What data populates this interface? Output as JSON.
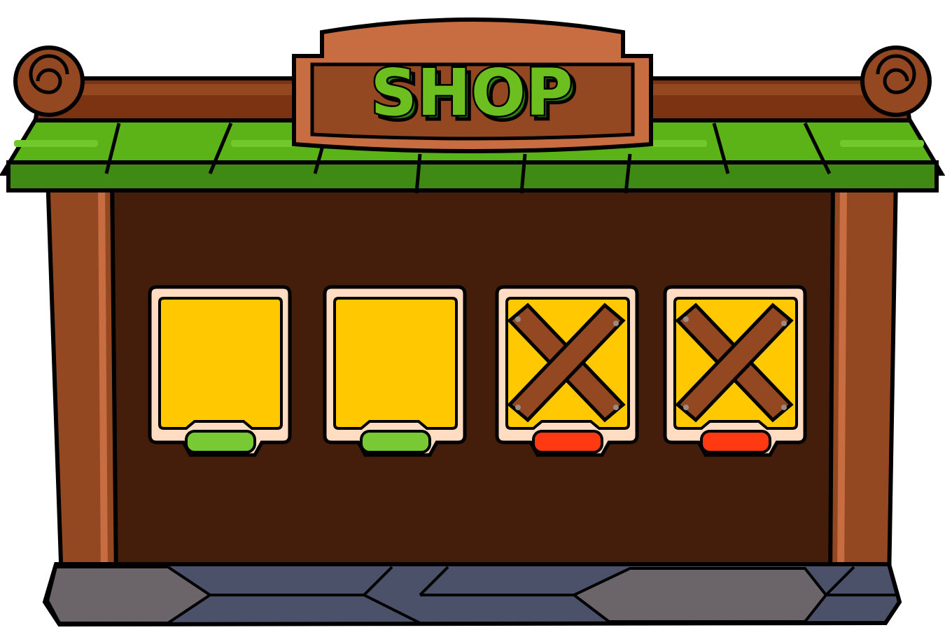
{
  "sign": {
    "title": "SHOP"
  },
  "slots": [
    {
      "state": "available",
      "button_color": "#79c934"
    },
    {
      "state": "available",
      "button_color": "#79c934"
    },
    {
      "state": "locked",
      "button_color": "#ff3a12"
    },
    {
      "state": "locked",
      "button_color": "#ff3a12"
    }
  ],
  "colors": {
    "roof_green": "#5cb318",
    "roof_green_dark": "#3f8a14",
    "wood": "#934821",
    "wood_light": "#c86c41",
    "back_panel": "#451d0b",
    "slot_fill": "#ffc800",
    "slot_frame": "#ffdcc2",
    "stone": "#4b5169",
    "stone_gray": "#6b6468",
    "title_green": "#6cbf1f"
  },
  "icons": {
    "locked_slot": "crossed-planks-icon",
    "scroll_ornament": "scroll-curl-icon"
  }
}
